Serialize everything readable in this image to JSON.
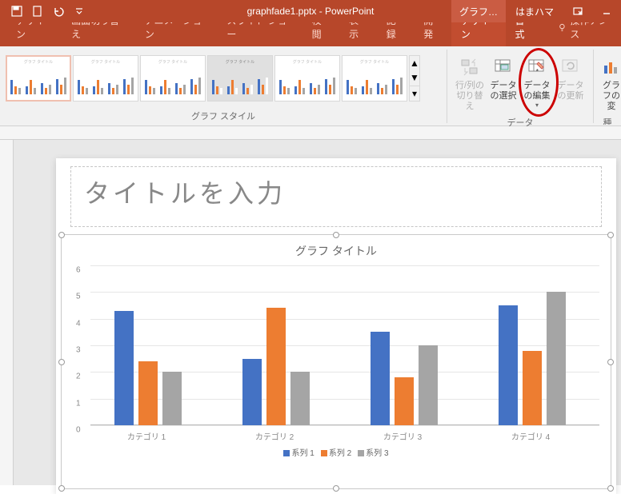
{
  "titlebar": {
    "filename": "graphfade1.pptx - PowerPoint",
    "context_tool": "グラフ…",
    "user": "はまハマ"
  },
  "ribbon_tabs": [
    "デザイン",
    "画面切り替え",
    "アニメーション",
    "スライド ショー",
    "校閲",
    "表示",
    "記録",
    "開発"
  ],
  "context_tabs": {
    "design": "デザイン",
    "format": "書式"
  },
  "tell_me": "操作アシス",
  "ribbon_groups": {
    "styles_label": "グラフ スタイル",
    "data_label": "データ",
    "type_label": "種",
    "switch_rowcol": "行/列の切り替え",
    "select_data": "データの選択",
    "edit_data": "データの編集",
    "refresh_data": "データの更新",
    "change_type": "グラフの変"
  },
  "slide": {
    "title_placeholder": "タイトルを入力"
  },
  "chart_data": {
    "type": "bar",
    "title": "グラフ タイトル",
    "categories": [
      "カテゴリ 1",
      "カテゴリ 2",
      "カテゴリ 3",
      "カテゴリ 4"
    ],
    "series": [
      {
        "name": "系列 1",
        "values": [
          4.3,
          2.5,
          3.5,
          4.5
        ]
      },
      {
        "name": "系列 2",
        "values": [
          2.4,
          4.4,
          1.8,
          2.8
        ]
      },
      {
        "name": "系列 3",
        "values": [
          2.0,
          2.0,
          3.0,
          5.0
        ]
      }
    ],
    "ylim": [
      0,
      6
    ],
    "yticks": [
      0,
      1,
      2,
      3,
      4,
      5,
      6
    ],
    "colors": {
      "系列 1": "#4472c4",
      "系列 2": "#ed7d31",
      "系列 3": "#a5a5a5"
    }
  }
}
